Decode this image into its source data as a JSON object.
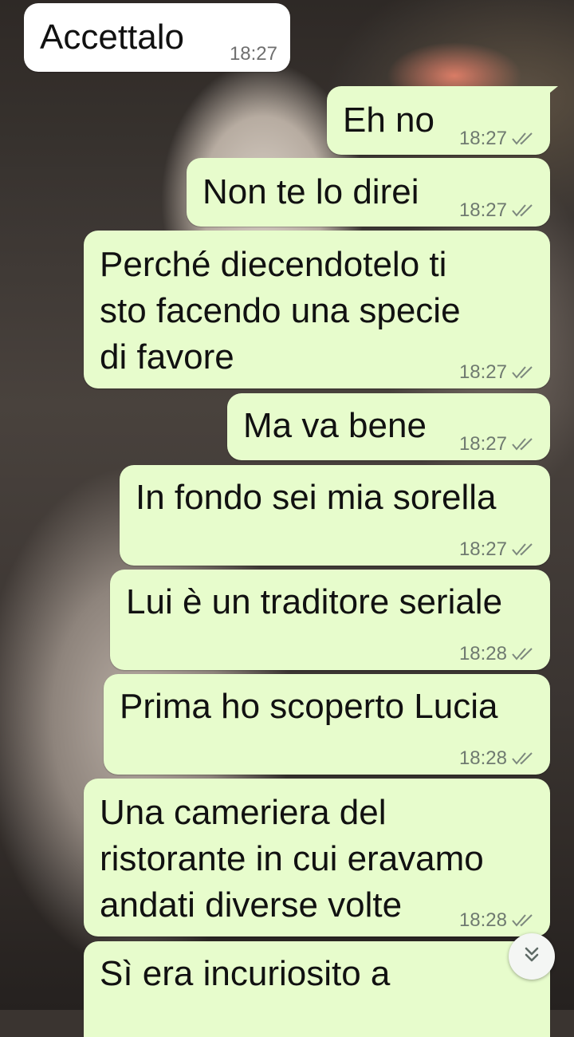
{
  "messages": [
    {
      "direction": "in",
      "text": "Accettalo",
      "time": "18:27"
    },
    {
      "direction": "out",
      "text": "Eh no",
      "time": "18:27",
      "status": "read"
    },
    {
      "direction": "out",
      "text": "Non te lo direi",
      "time": "18:27",
      "status": "read"
    },
    {
      "direction": "out",
      "lines": [
        "Perché diecendotelo ti",
        "sto facendo una specie",
        "di favore"
      ],
      "time": "18:27",
      "status": "read"
    },
    {
      "direction": "out",
      "text": "Ma va bene",
      "time": "18:27",
      "status": "read"
    },
    {
      "direction": "out",
      "text": "In fondo sei mia sorella",
      "time": "18:27",
      "status": "read"
    },
    {
      "direction": "out",
      "text": "Lui è un traditore seriale",
      "time": "18:28",
      "status": "read"
    },
    {
      "direction": "out",
      "text": "Prima ho scoperto Lucia",
      "time": "18:28",
      "status": "read"
    },
    {
      "direction": "out",
      "lines": [
        "Una cameriera del",
        "ristorante in cui eravamo",
        "andati diverse volte"
      ],
      "time": "18:28",
      "status": "read"
    },
    {
      "direction": "out",
      "text": "Sì era incuriosito a",
      "time": "",
      "status": ""
    }
  ],
  "scroll_button": {
    "icon": "double-chevron-down-icon"
  },
  "colors": {
    "outgoing_bubble": "#e7fccc",
    "incoming_bubble": "#ffffff",
    "tick": "#6f7a70"
  }
}
